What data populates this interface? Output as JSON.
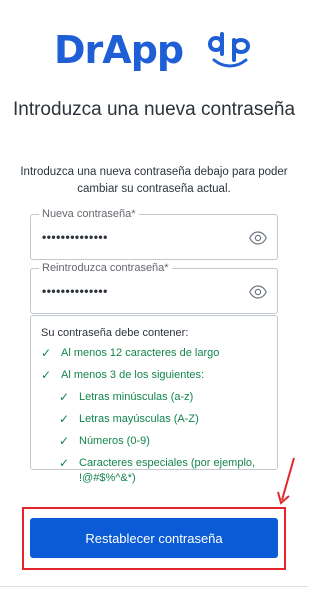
{
  "logo": {
    "brand": "DrApp",
    "brand_dr": "Dr",
    "brand_app": "App"
  },
  "header": {
    "title": "Introduzca una nueva contraseña",
    "subtitle": "Introduzca una nueva contraseña debajo para poder cambiar su contraseña actual."
  },
  "form": {
    "new_password": {
      "label": "Nueva contraseña*",
      "value": "••••••••••••••"
    },
    "repeat_password": {
      "label": "Reintroduzca contraseña*",
      "value": "••••••••••••••"
    }
  },
  "rules": {
    "title": "Su contraseña debe contener:",
    "items": [
      "Al menos 12 caracteres de largo",
      "Al menos 3 de los siguientes:"
    ],
    "sub_items": [
      "Letras minúsculas (a-z)",
      "Letras mayúsculas (A-Z)",
      "Números (0-9)",
      "Caracteres especiales (por ejemplo, !@#$%^&*)"
    ],
    "check": "✓"
  },
  "submit_label": "Restablecer contraseña",
  "colors": {
    "brand": "#1f5fd6",
    "button": "#0b5bd6",
    "success": "#13854e",
    "annotation": "#e4262c"
  },
  "icons": {
    "password_toggle": "eye-icon",
    "logo_mark": "dp-logo-icon"
  }
}
